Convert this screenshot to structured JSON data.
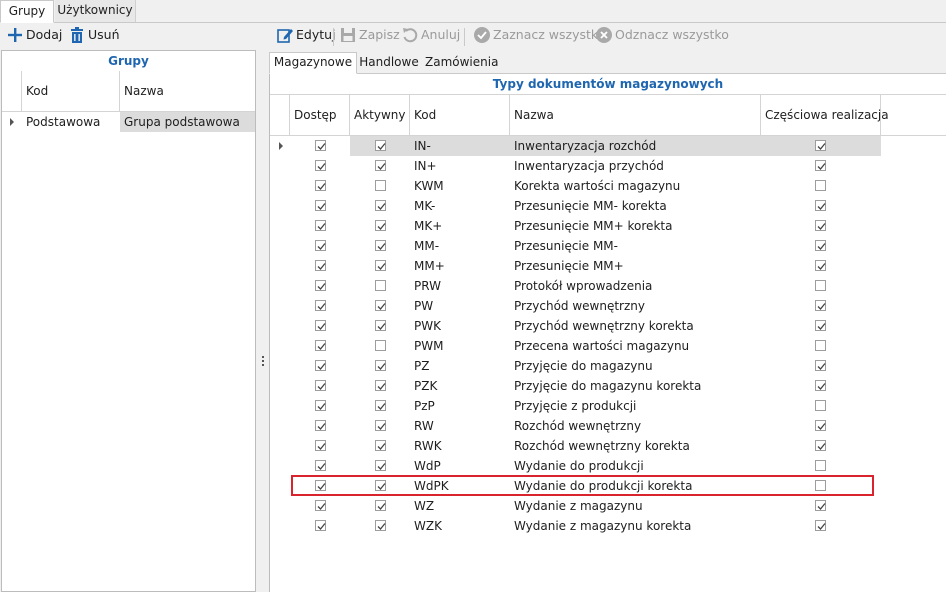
{
  "top_tabs": [
    "Grupy",
    "Użytkownicy"
  ],
  "left_toolbar": {
    "add_label": "Dodaj",
    "delete_label": "Usuń"
  },
  "right_toolbar": {
    "edit_label": "Edytuj",
    "save_label": "Zapisz",
    "cancel_label": "Anuluj",
    "select_all_label": "Zaznacz wszystko",
    "deselect_all_label": "Odznacz wszystko"
  },
  "groups_panel": {
    "title": "Grupy",
    "columns": [
      "Kod",
      "Nazwa"
    ],
    "rows": [
      {
        "kod": "Podstawowa",
        "nazwa": "Grupa podstawowa"
      }
    ]
  },
  "doc_tabs": [
    "Magazynowe",
    "Handlowe",
    "Zamówienia"
  ],
  "doc_grid": {
    "title": "Typy dokumentów magazynowych",
    "columns": [
      "Dostęp",
      "Aktywny",
      "Kod",
      "Nazwa",
      "Częściowa realizacja"
    ],
    "highlighted_row_index": 17,
    "rows": [
      {
        "dostep": true,
        "aktywny": true,
        "kod": "IN-",
        "nazwa": "Inwentaryzacja rozchód",
        "czesciowa": true
      },
      {
        "dostep": true,
        "aktywny": true,
        "kod": "IN+",
        "nazwa": "Inwentaryzacja przychód",
        "czesciowa": true
      },
      {
        "dostep": true,
        "aktywny": false,
        "kod": "KWM",
        "nazwa": "Korekta wartości magazynu",
        "czesciowa": false
      },
      {
        "dostep": true,
        "aktywny": true,
        "kod": "MK-",
        "nazwa": "Przesunięcie MM- korekta",
        "czesciowa": true
      },
      {
        "dostep": true,
        "aktywny": true,
        "kod": "MK+",
        "nazwa": "Przesunięcie MM+ korekta",
        "czesciowa": true
      },
      {
        "dostep": true,
        "aktywny": true,
        "kod": "MM-",
        "nazwa": "Przesunięcie MM-",
        "czesciowa": true
      },
      {
        "dostep": true,
        "aktywny": true,
        "kod": "MM+",
        "nazwa": "Przesunięcie MM+",
        "czesciowa": true
      },
      {
        "dostep": true,
        "aktywny": false,
        "kod": "PRW",
        "nazwa": "Protokół wprowadzenia",
        "czesciowa": false
      },
      {
        "dostep": true,
        "aktywny": true,
        "kod": "PW",
        "nazwa": "Przychód wewnętrzny",
        "czesciowa": true
      },
      {
        "dostep": true,
        "aktywny": true,
        "kod": "PWK",
        "nazwa": "Przychód wewnętrzny korekta",
        "czesciowa": true
      },
      {
        "dostep": true,
        "aktywny": false,
        "kod": "PWM",
        "nazwa": "Przecena wartości magazynu",
        "czesciowa": false
      },
      {
        "dostep": true,
        "aktywny": true,
        "kod": "PZ",
        "nazwa": "Przyjęcie do magazynu",
        "czesciowa": true
      },
      {
        "dostep": true,
        "aktywny": true,
        "kod": "PZK",
        "nazwa": "Przyjęcie do magazynu korekta",
        "czesciowa": true
      },
      {
        "dostep": true,
        "aktywny": true,
        "kod": "PzP",
        "nazwa": "Przyjęcie z produkcji",
        "czesciowa": false
      },
      {
        "dostep": true,
        "aktywny": true,
        "kod": "RW",
        "nazwa": "Rozchód wewnętrzny",
        "czesciowa": true
      },
      {
        "dostep": true,
        "aktywny": true,
        "kod": "RWK",
        "nazwa": "Rozchód wewnętrzny korekta",
        "czesciowa": true
      },
      {
        "dostep": true,
        "aktywny": true,
        "kod": "WdP",
        "nazwa": "Wydanie do produkcji",
        "czesciowa": false
      },
      {
        "dostep": true,
        "aktywny": true,
        "kod": "WdPK",
        "nazwa": "Wydanie do produkcji korekta",
        "czesciowa": false
      },
      {
        "dostep": true,
        "aktywny": true,
        "kod": "WZ",
        "nazwa": "Wydanie z magazynu",
        "czesciowa": true
      },
      {
        "dostep": true,
        "aktywny": true,
        "kod": "WZK",
        "nazwa": "Wydanie z magazynu korekta",
        "czesciowa": true
      }
    ]
  },
  "colors": {
    "accent_blue": "#1f66b0",
    "highlight_red": "#d9232d",
    "selected_row": "#dcdcdc"
  },
  "icons": [
    "plus-icon",
    "trash-icon",
    "edit-icon",
    "save-icon",
    "undo-icon",
    "check-circle-icon",
    "x-circle-icon",
    "row-indicator-icon",
    "splitter-grip-icon"
  ]
}
